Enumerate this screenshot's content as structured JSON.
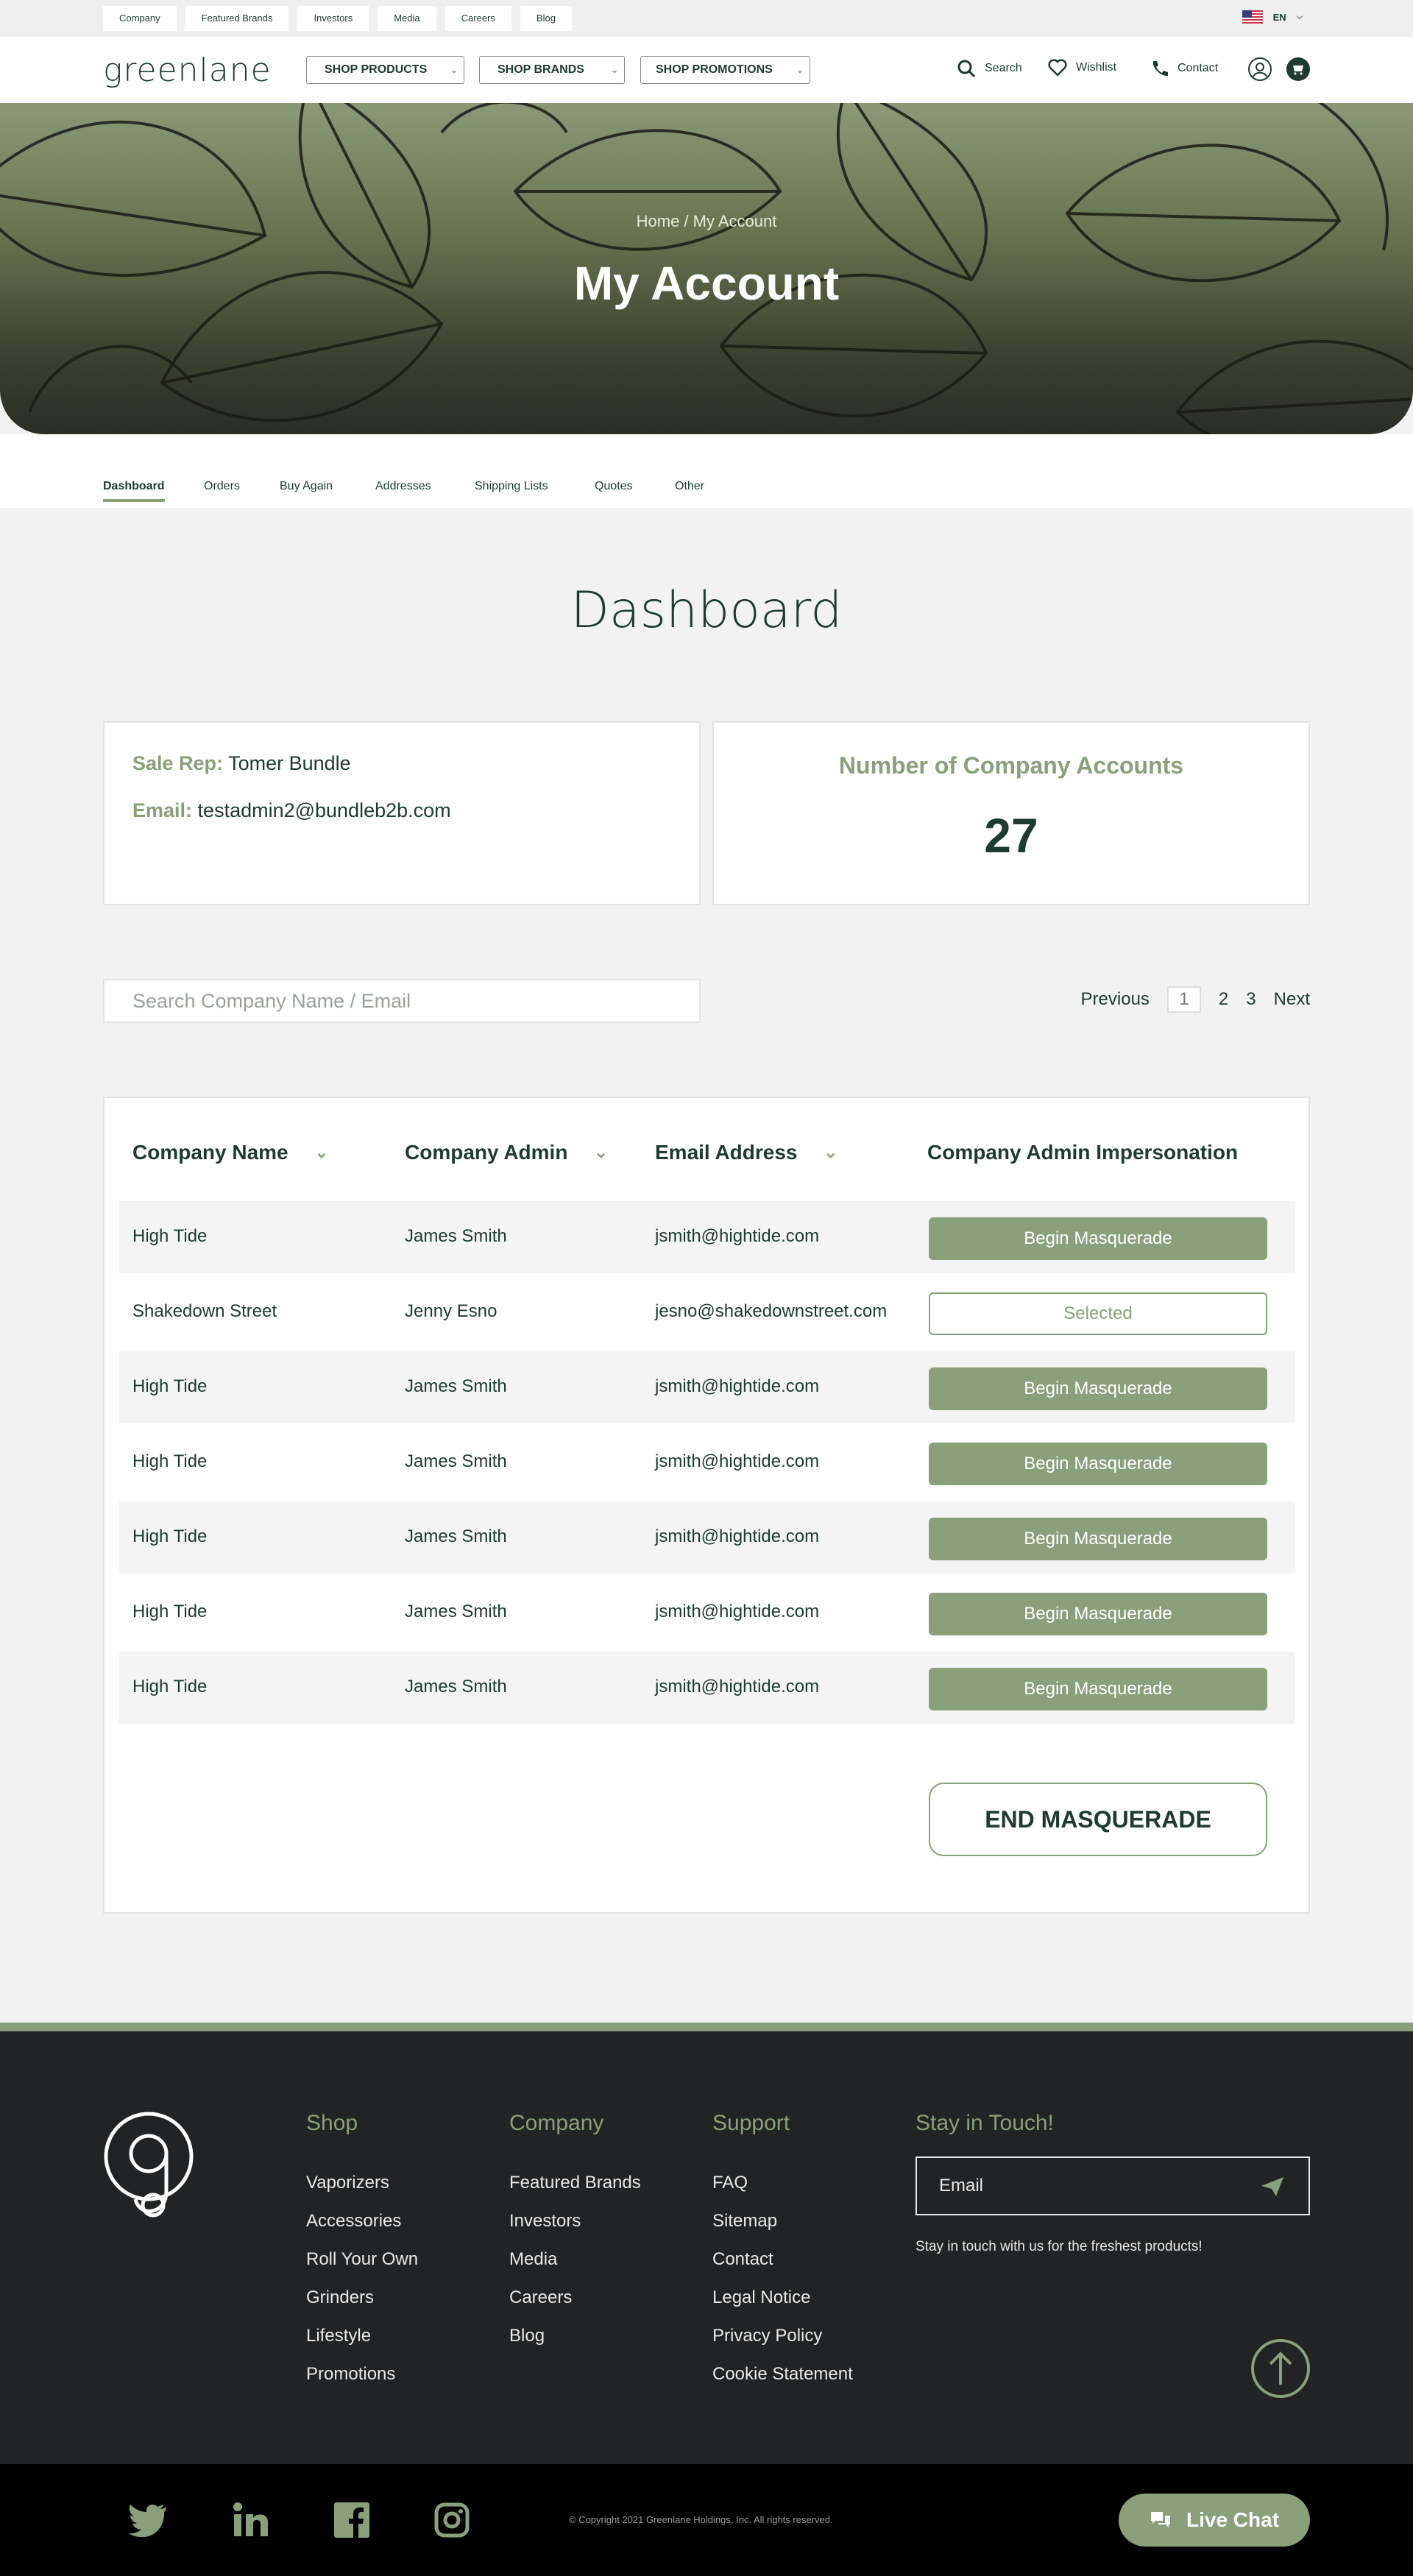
{
  "topbar": {
    "links": [
      "Company",
      "Featured Brands",
      "Investors",
      "Media",
      "Careers",
      "Blog"
    ],
    "language": "EN"
  },
  "header": {
    "logo": "greenlane",
    "shop_products": "SHOP PRODUCTS",
    "shop_brands": "SHOP BRANDS",
    "shop_promotions": "SHOP PROMOTIONS",
    "search": "Search",
    "wishlist": "Wishlist",
    "contact": "Contact"
  },
  "hero": {
    "breadcrumb": "Home / My Account",
    "title": "My Account"
  },
  "tabs": [
    "Dashboard",
    "Orders",
    "Buy Again",
    "Addresses",
    "Shipping Lists",
    "Quotes",
    "Other"
  ],
  "dashboard": {
    "title": "Dashboard",
    "sale_rep_label": "Sale Rep:",
    "sale_rep_value": "Tomer Bundle",
    "email_label": "Email:",
    "email_value": "testadmin2@bundleb2b.com",
    "accounts_label": "Number of Company Accounts",
    "accounts_count": "27"
  },
  "search": {
    "placeholder": "Search Company Name / Email"
  },
  "pagination": {
    "previous": "Previous",
    "pages": [
      "1",
      "2",
      "3"
    ],
    "current": "1",
    "next": "Next"
  },
  "table": {
    "headers": [
      "Company Name",
      "Company Admin",
      "Email Address",
      "Company Admin Impersonation"
    ],
    "rows": [
      {
        "company": "High Tide",
        "admin": "James Smith",
        "email": "jsmith@hightide.com",
        "action": "Begin Masquerade"
      },
      {
        "company": "Shakedown Street",
        "admin": "Jenny Esno",
        "email": "jesno@shakedownstreet.com",
        "action": "Selected"
      },
      {
        "company": "High Tide",
        "admin": "James Smith",
        "email": "jsmith@hightide.com",
        "action": "Begin Masquerade"
      },
      {
        "company": "High Tide",
        "admin": "James Smith",
        "email": "jsmith@hightide.com",
        "action": "Begin Masquerade"
      },
      {
        "company": "High Tide",
        "admin": "James Smith",
        "email": "jsmith@hightide.com",
        "action": "Begin Masquerade"
      },
      {
        "company": "High Tide",
        "admin": "James Smith",
        "email": "jsmith@hightide.com",
        "action": "Begin Masquerade"
      },
      {
        "company": "High Tide",
        "admin": "James Smith",
        "email": "jsmith@hightide.com",
        "action": "Begin Masquerade"
      }
    ],
    "end_button": "END MASQUERADE"
  },
  "footer": {
    "shop": {
      "title": "Shop",
      "links": [
        "Vaporizers",
        "Accessories",
        "Roll Your Own",
        "Grinders",
        "Lifestyle",
        "Promotions"
      ]
    },
    "company": {
      "title": "Company",
      "links": [
        "Featured Brands",
        "Investors",
        "Media",
        "Careers",
        "Blog"
      ]
    },
    "support": {
      "title": "Support",
      "links": [
        "FAQ",
        "Sitemap",
        "Contact",
        "Legal Notice",
        "Privacy Policy",
        "Cookie Statement"
      ]
    },
    "stay": {
      "title": "Stay in Touch!",
      "email_placeholder": "Email",
      "note": "Stay in touch with us for the freshest products!"
    },
    "copyright": "© Copyright 2021 Greenlane Holdings, Inc. All rights reserved.",
    "live_chat": "Live Chat",
    "social_icons": [
      "twitter-icon",
      "linkedin-icon",
      "facebook-icon",
      "instagram-icon"
    ]
  },
  "colors": {
    "brand_green": "#8aa07a",
    "dark_green": "#1e3b2f",
    "footer_bg": "#222324"
  }
}
